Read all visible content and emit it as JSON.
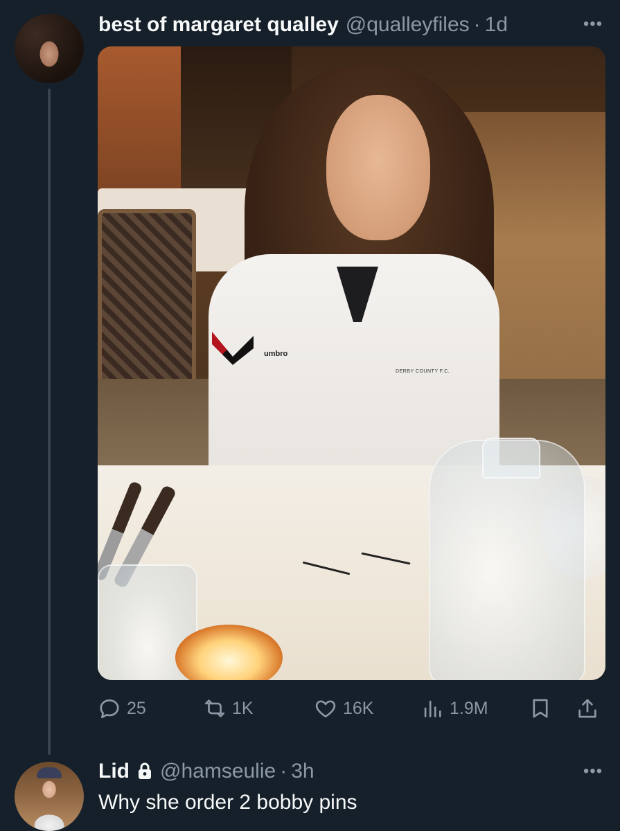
{
  "tweet": {
    "display_name": "best of margaret qualley",
    "handle": "@qualleyfiles",
    "separator": "·",
    "time": "1d",
    "more_icon": "more-horizontal-icon",
    "media": {
      "shirt_brand_text": "umbro",
      "shirt_club_text": "DERBY COUNTY F.C."
    },
    "actions": {
      "replies": "25",
      "retweets": "1K",
      "likes": "16K",
      "views": "1.9M"
    }
  },
  "reply": {
    "display_name": "Lid",
    "protected_icon": "lock-icon",
    "handle": "@hamseulie",
    "separator": "·",
    "time": "3h",
    "text": "Why she order 2 bobby pins",
    "more_icon": "more-horizontal-icon"
  },
  "colors": {
    "background": "#15202b",
    "primary_text": "#f7f9f9",
    "secondary_text": "#8b98a5",
    "thread_line": "#38444d"
  }
}
